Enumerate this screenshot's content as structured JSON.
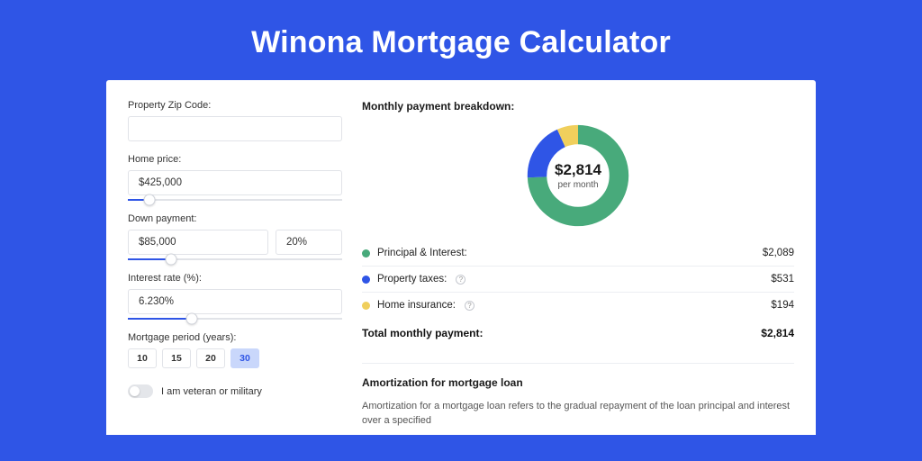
{
  "page_title": "Winona Mortgage Calculator",
  "form": {
    "zip": {
      "label": "Property Zip Code:",
      "value": ""
    },
    "home_price": {
      "label": "Home price:",
      "value": "$425,000",
      "slider_pct": 10
    },
    "down_payment": {
      "label": "Down payment:",
      "value": "$85,000",
      "pct": "20%",
      "slider_pct": 20
    },
    "interest_rate": {
      "label": "Interest rate (%):",
      "value": "6.230%",
      "slider_pct": 30
    },
    "period": {
      "label": "Mortgage period (years):",
      "options": [
        "10",
        "15",
        "20",
        "30"
      ],
      "active": "30"
    },
    "veteran": {
      "label": "I am veteran or military",
      "on": false
    }
  },
  "breakdown": {
    "heading": "Monthly payment breakdown:",
    "center_amount": "$2,814",
    "center_period": "per month",
    "items": [
      {
        "label": "Principal & Interest:",
        "value": "$2,089",
        "value_num": 2089,
        "color": "#48aa7b",
        "info": false
      },
      {
        "label": "Property taxes:",
        "value": "$531",
        "value_num": 531,
        "color": "#2f55e6",
        "info": true
      },
      {
        "label": "Home insurance:",
        "value": "$194",
        "value_num": 194,
        "color": "#f0cf5c",
        "info": true
      }
    ],
    "total": {
      "label": "Total monthly payment:",
      "value": "$2,814"
    }
  },
  "amortization": {
    "heading": "Amortization for mortgage loan",
    "text": "Amortization for a mortgage loan refers to the gradual repayment of the loan principal and interest over a specified"
  },
  "chart_data": {
    "type": "pie",
    "title": "Monthly payment breakdown",
    "series": [
      {
        "name": "Principal & Interest",
        "value": 2089,
        "color": "#48aa7b"
      },
      {
        "name": "Property taxes",
        "value": 531,
        "color": "#2f55e6"
      },
      {
        "name": "Home insurance",
        "value": 194,
        "color": "#f0cf5c"
      }
    ],
    "total": 2814,
    "center_label": "$2,814 per month"
  }
}
